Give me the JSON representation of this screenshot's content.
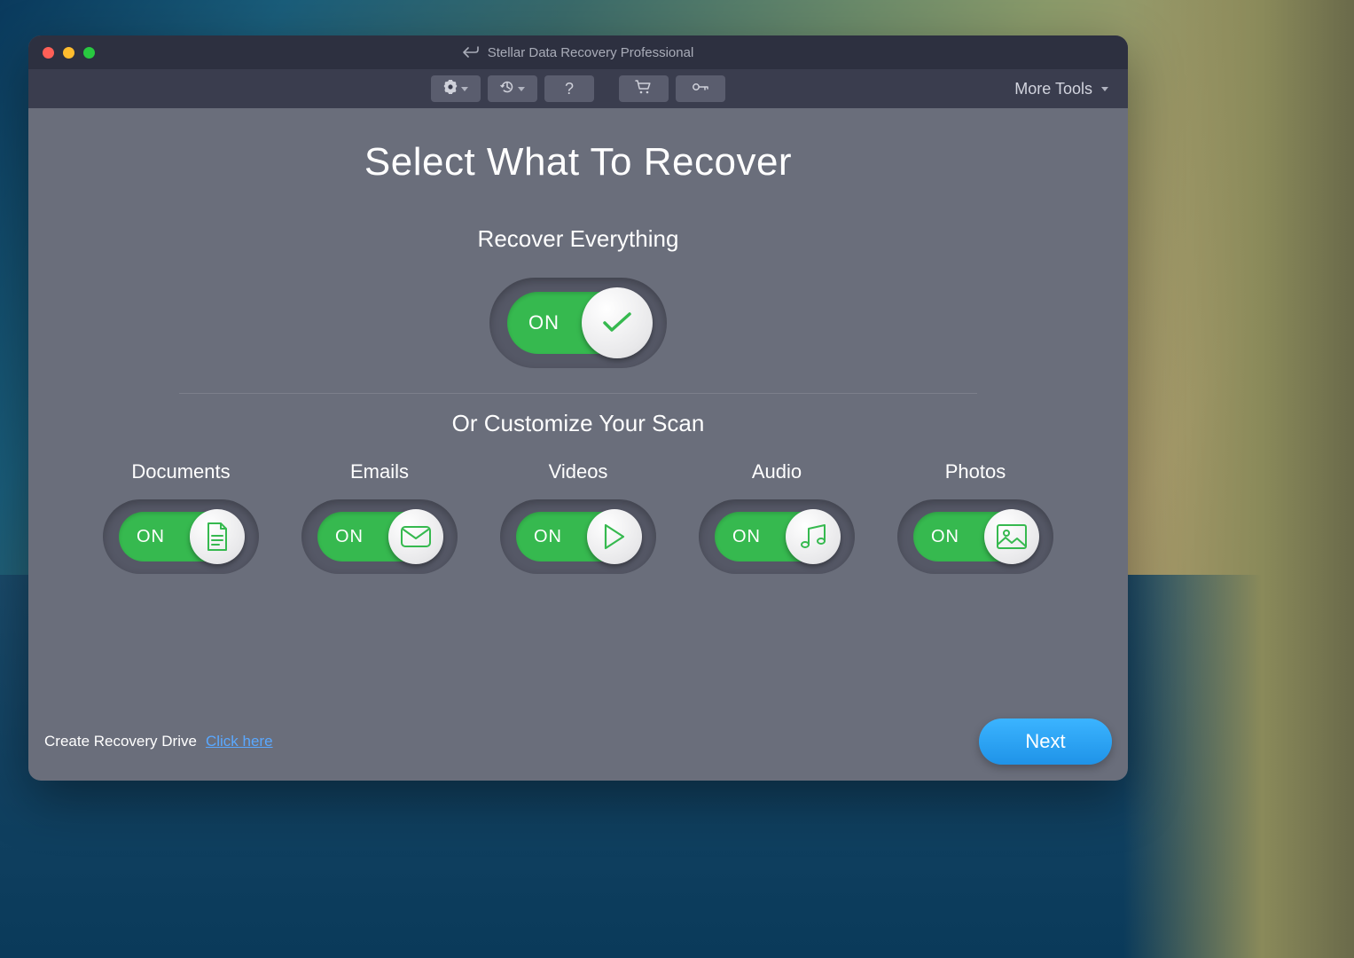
{
  "window": {
    "title": "Stellar Data Recovery Professional"
  },
  "toolbar": {
    "more_tools_label": "More Tools"
  },
  "main": {
    "heading": "Select What To Recover",
    "recover_everything_label": "Recover Everything",
    "master_toggle": {
      "state": "ON",
      "label": "ON"
    },
    "customize_label": "Or Customize Your Scan",
    "categories": [
      {
        "name": "Documents",
        "state": "ON",
        "label": "ON",
        "icon": "document-icon"
      },
      {
        "name": "Emails",
        "state": "ON",
        "label": "ON",
        "icon": "email-icon"
      },
      {
        "name": "Videos",
        "state": "ON",
        "label": "ON",
        "icon": "play-icon"
      },
      {
        "name": "Audio",
        "state": "ON",
        "label": "ON",
        "icon": "music-icon"
      },
      {
        "name": "Photos",
        "state": "ON",
        "label": "ON",
        "icon": "image-icon"
      }
    ]
  },
  "footer": {
    "create_drive_label": "Create Recovery Drive",
    "click_here_label": "Click here",
    "next_label": "Next"
  },
  "colors": {
    "accent_green": "#36b94f",
    "accent_blue": "#2aa0f0",
    "window_bg": "#6a6e7b",
    "titlebar_bg": "#2d3040",
    "toolbar_bg": "#3a3d4e"
  }
}
